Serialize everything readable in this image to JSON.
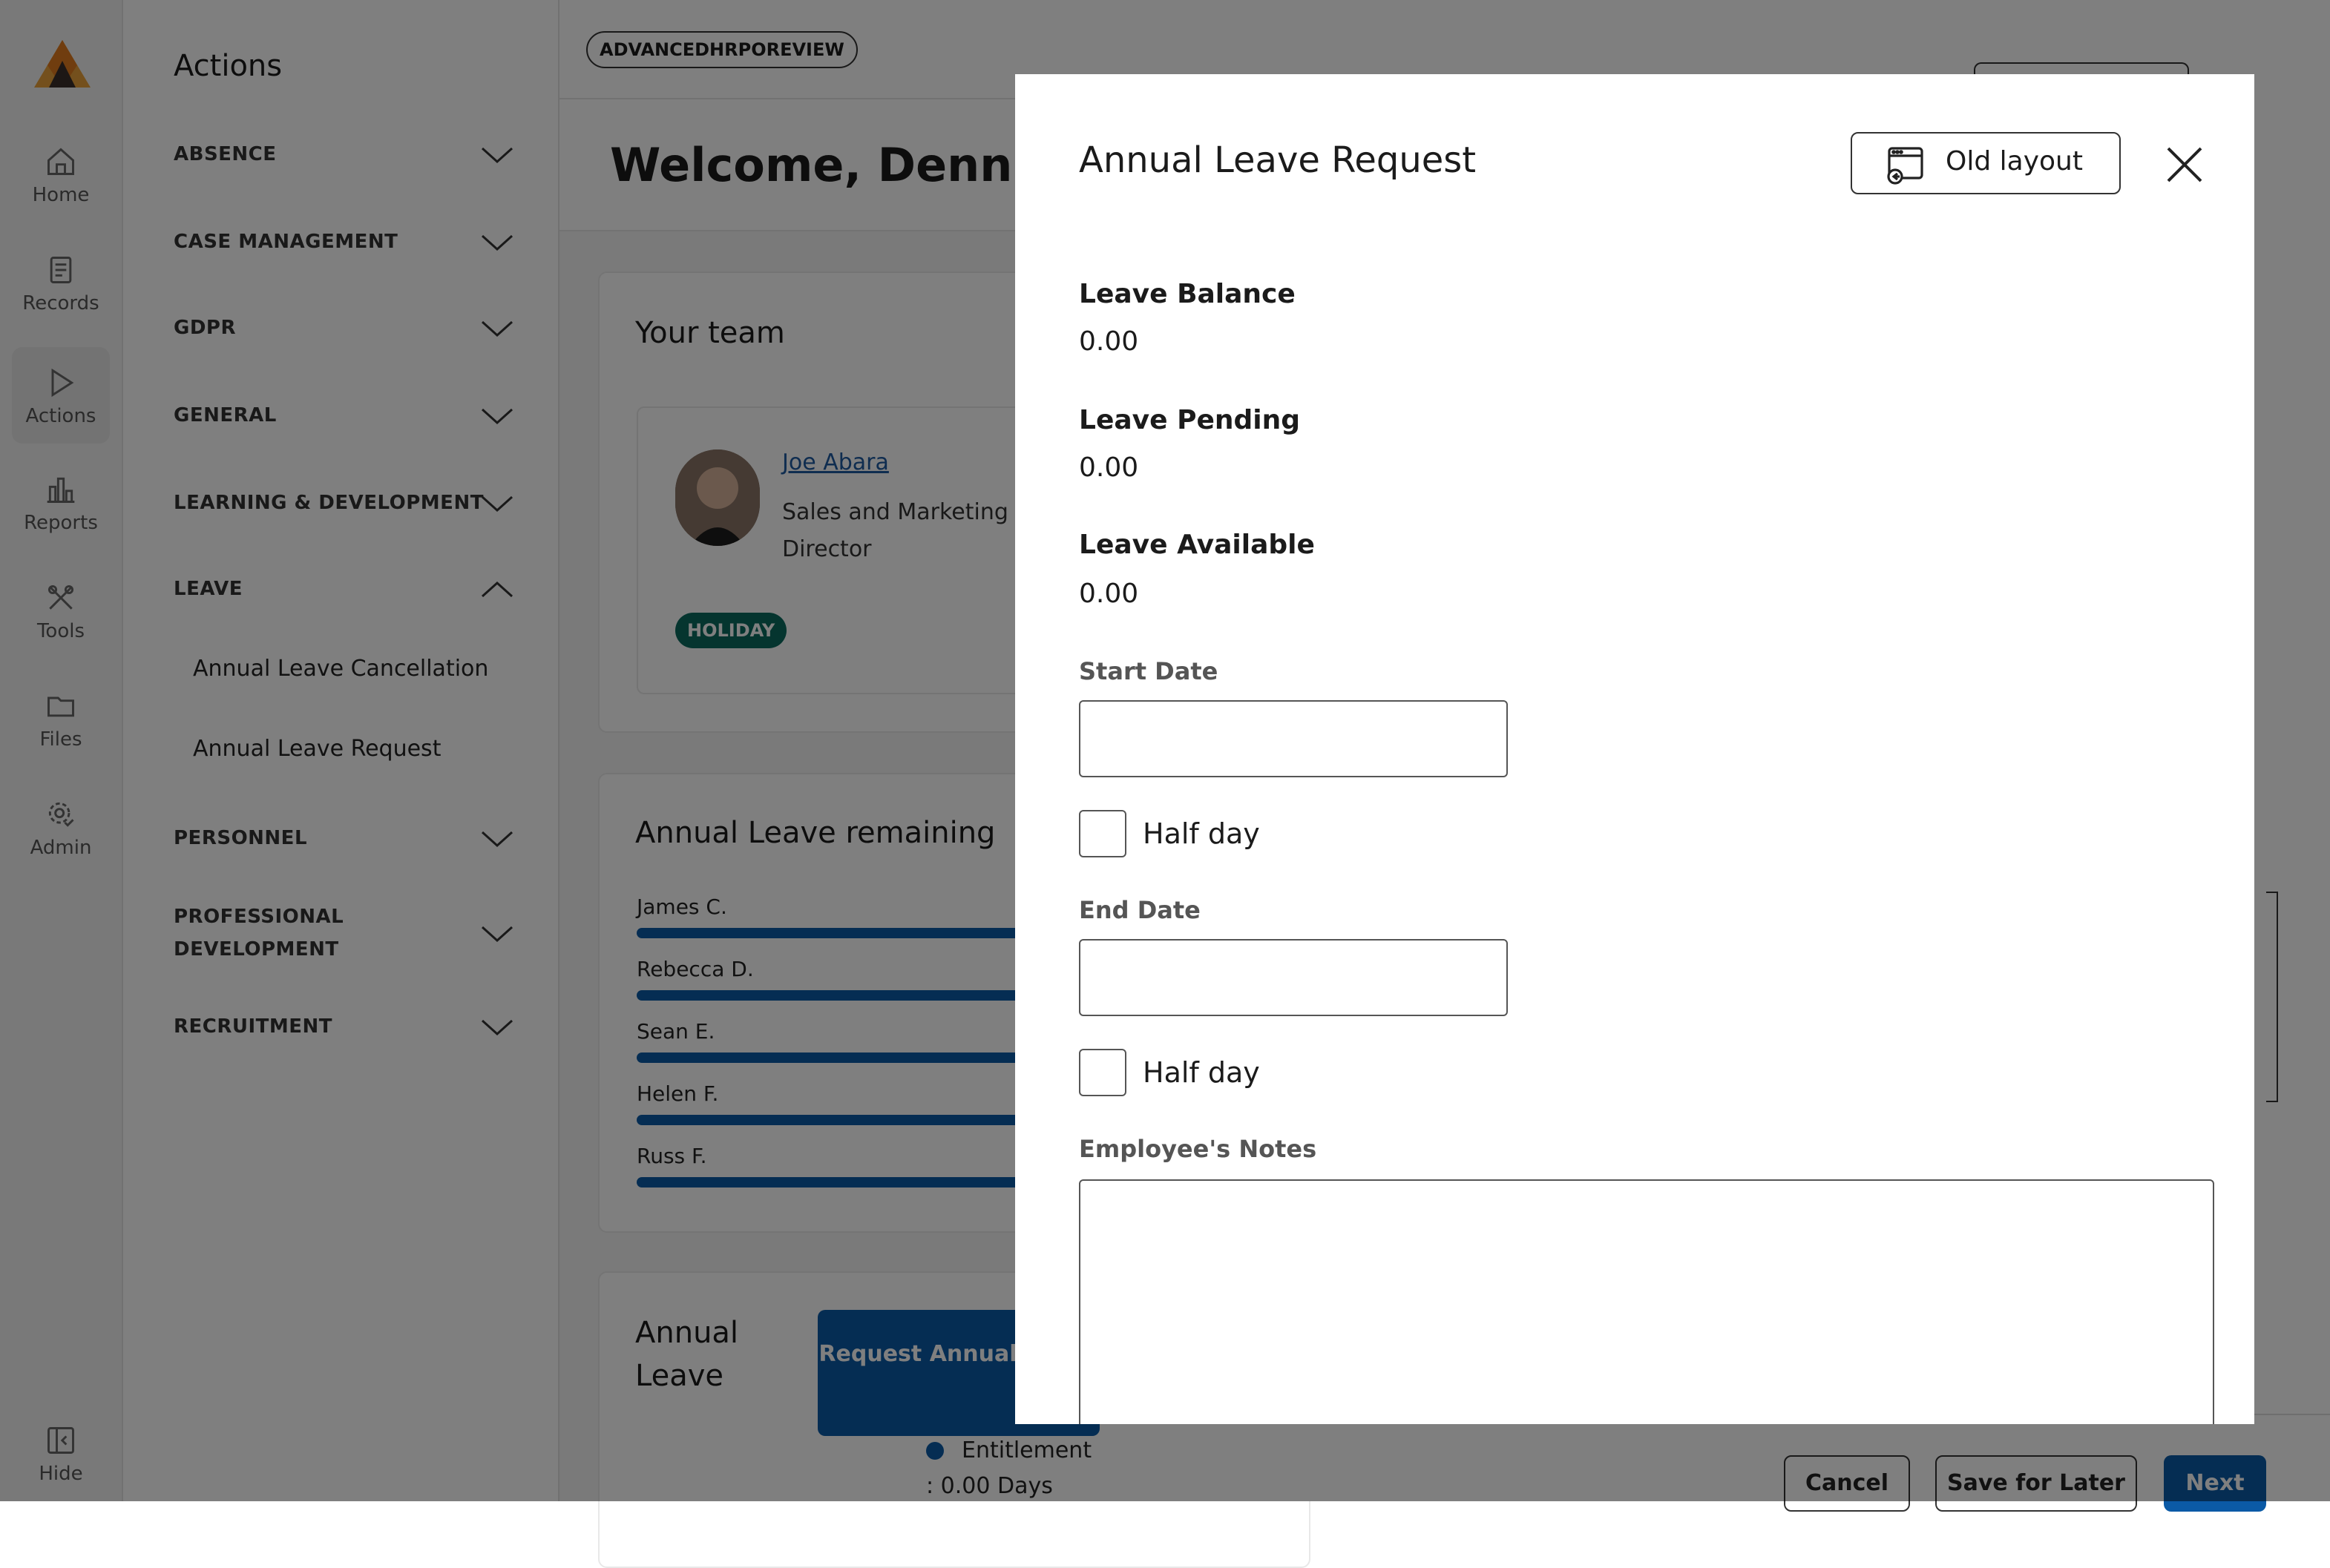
{
  "rail": {
    "items": [
      {
        "label": "Home",
        "icon": "home-icon"
      },
      {
        "label": "Records",
        "icon": "records-icon"
      },
      {
        "label": "Actions",
        "icon": "actions-icon",
        "active": true
      },
      {
        "label": "Reports",
        "icon": "reports-icon"
      },
      {
        "label": "Tools",
        "icon": "tools-icon"
      },
      {
        "label": "Files",
        "icon": "files-icon"
      },
      {
        "label": "Admin",
        "icon": "admin-icon"
      }
    ],
    "hide_label": "Hide"
  },
  "actions": {
    "title": "Actions",
    "categories": [
      "ABSENCE",
      "CASE MANAGEMENT",
      "GDPR",
      "GENERAL",
      "LEARNING & DEVELOPMENT",
      "LEAVE",
      "PERSONNEL",
      "PROFESSIONAL DEVELOPMENT",
      "RECRUITMENT"
    ],
    "leave_items": [
      "Annual Leave Cancellation",
      "Annual Leave Request"
    ]
  },
  "dashboard": {
    "env_badge": "ADVANCEDHRPOREVIEW",
    "welcome": "Welcome, Dennis",
    "team_title": "Your team",
    "member": {
      "name": "Joe Abara",
      "role": "Sales and Marketing Director",
      "badge": "HOLIDAY"
    },
    "leave_remaining_title": "Annual Leave remaining",
    "leave_remaining": [
      "James C.",
      "Rebecca D.",
      "Sean E.",
      "Helen F.",
      "Russ F."
    ],
    "annual_leave_title": "Annual Leave",
    "request_button": "Request Annual Leave",
    "legend": [
      "Entitlement",
      ": 0.00 Days"
    ]
  },
  "footer": {
    "cancel": "Cancel",
    "save_later": "Save for Later",
    "next": "Next"
  },
  "modal": {
    "title": "Annual Leave Request",
    "old_layout": "Old layout",
    "leave_balance_label": "Leave Balance",
    "leave_balance_value": "0.00",
    "leave_pending_label": "Leave Pending",
    "leave_pending_value": "0.00",
    "leave_available_label": "Leave Available",
    "leave_available_value": "0.00",
    "start_date_label": "Start Date",
    "start_date_value": "",
    "half_day_label": "Half day",
    "end_date_label": "End Date",
    "end_date_value": "",
    "notes_label": "Employee's Notes",
    "notes_value": ""
  }
}
